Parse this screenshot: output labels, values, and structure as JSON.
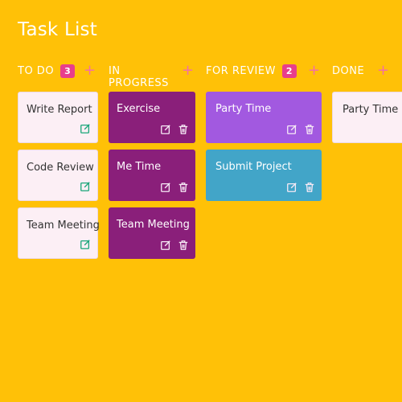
{
  "app": {
    "title": "Task List"
  },
  "columns": [
    {
      "name": "TO DO",
      "count": "3",
      "cards": [
        "Write Report",
        "Code Review",
        "Team Meeting"
      ]
    },
    {
      "name": "IN PROGRESS",
      "count": null,
      "cards": [
        "Exercise",
        "Me Time",
        "Team Meeting"
      ]
    },
    {
      "name": "FOR REVIEW",
      "count": "2",
      "cards": [
        "Party Time",
        "Submit Project"
      ]
    },
    {
      "name": "DONE",
      "count": null,
      "cards": [
        "Party Time"
      ]
    }
  ],
  "icons": {
    "add": "plus-icon",
    "edit": "edit-icon",
    "delete": "trash-icon"
  },
  "colors": {
    "background": "#FFC107",
    "todo_card": "#FCEFF5",
    "inprogress_card": "#8A1F7A",
    "review_card_1": "#A259E0",
    "review_card_2": "#42A5C8",
    "badge": "#E83E8C"
  }
}
